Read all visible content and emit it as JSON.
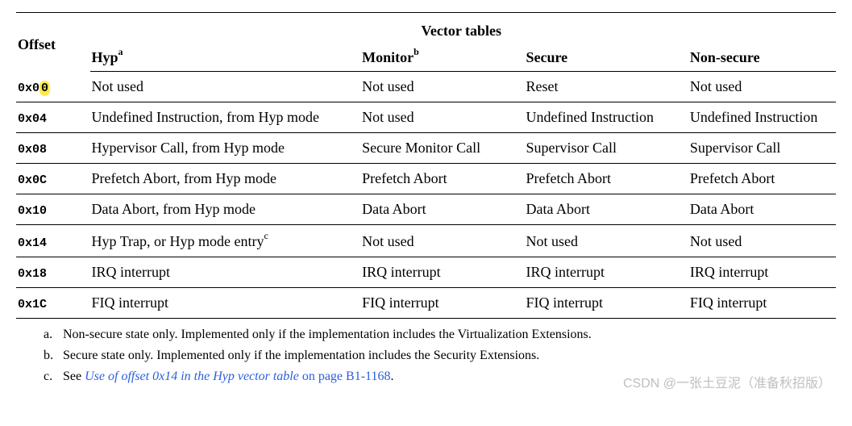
{
  "headers": {
    "title": "Vector tables",
    "offset_col": "Offset",
    "cols": [
      "Hyp",
      "Monitor",
      "Secure",
      "Non-secure"
    ],
    "sups": [
      "a",
      "b",
      "",
      ""
    ]
  },
  "rows": [
    {
      "offset": "0x00",
      "highlight_last": true,
      "cells": [
        "Not used",
        "Not used",
        "Reset",
        "Not used"
      ],
      "sup": ""
    },
    {
      "offset": "0x04",
      "cells": [
        "Undefined Instruction, from Hyp mode",
        "Not used",
        "Undefined Instruction",
        "Undefined Instruction"
      ],
      "sup": ""
    },
    {
      "offset": "0x08",
      "cells": [
        "Hypervisor Call, from Hyp mode",
        "Secure Monitor Call",
        "Supervisor Call",
        "Supervisor Call"
      ],
      "sup": ""
    },
    {
      "offset": "0x0C",
      "cells": [
        "Prefetch Abort, from Hyp mode",
        "Prefetch Abort",
        "Prefetch Abort",
        "Prefetch Abort"
      ],
      "sup": ""
    },
    {
      "offset": "0x10",
      "cells": [
        "Data Abort, from Hyp mode",
        "Data Abort",
        "Data Abort",
        "Data Abort"
      ],
      "sup": ""
    },
    {
      "offset": "0x14",
      "cells": [
        "Hyp Trap, or Hyp mode entry",
        "Not used",
        "Not used",
        "Not used"
      ],
      "sup": "c"
    },
    {
      "offset": "0x18",
      "cells": [
        "IRQ interrupt",
        "IRQ interrupt",
        "IRQ interrupt",
        "IRQ interrupt"
      ],
      "sup": ""
    },
    {
      "offset": "0x1C",
      "cells": [
        "FIQ interrupt",
        "FIQ interrupt",
        "FIQ interrupt",
        "FIQ interrupt"
      ],
      "sup": ""
    }
  ],
  "footnotes": [
    {
      "m": "a.",
      "text": "Non-secure state only. Implemented only if the implementation includes the Virtualization Extensions."
    },
    {
      "m": "b.",
      "text": "Secure state only. Implemented only if the implementation includes the Security Extensions."
    },
    {
      "m": "c.",
      "prefix": "See ",
      "link": "Use of offset 0x14 in the Hyp vector table",
      "link_tail": " on page B1-1168",
      "suffix": "."
    }
  ],
  "watermark": "CSDN @一张土豆泥（准备秋招版）",
  "chart_data": {
    "type": "table",
    "title": "Vector tables",
    "columns": [
      "Offset",
      "Hyp",
      "Monitor",
      "Secure",
      "Non-secure"
    ],
    "rows": [
      [
        "0x00",
        "Not used",
        "Not used",
        "Reset",
        "Not used"
      ],
      [
        "0x04",
        "Undefined Instruction, from Hyp mode",
        "Not used",
        "Undefined Instruction",
        "Undefined Instruction"
      ],
      [
        "0x08",
        "Hypervisor Call, from Hyp mode",
        "Secure Monitor Call",
        "Supervisor Call",
        "Supervisor Call"
      ],
      [
        "0x0C",
        "Prefetch Abort, from Hyp mode",
        "Prefetch Abort",
        "Prefetch Abort",
        "Prefetch Abort"
      ],
      [
        "0x10",
        "Data Abort, from Hyp mode",
        "Data Abort",
        "Data Abort",
        "Data Abort"
      ],
      [
        "0x14",
        "Hyp Trap, or Hyp mode entry",
        "Not used",
        "Not used",
        "Not used"
      ],
      [
        "0x18",
        "IRQ interrupt",
        "IRQ interrupt",
        "IRQ interrupt",
        "IRQ interrupt"
      ],
      [
        "0x1C",
        "FIQ interrupt",
        "FIQ interrupt",
        "FIQ interrupt",
        "FIQ interrupt"
      ]
    ]
  }
}
